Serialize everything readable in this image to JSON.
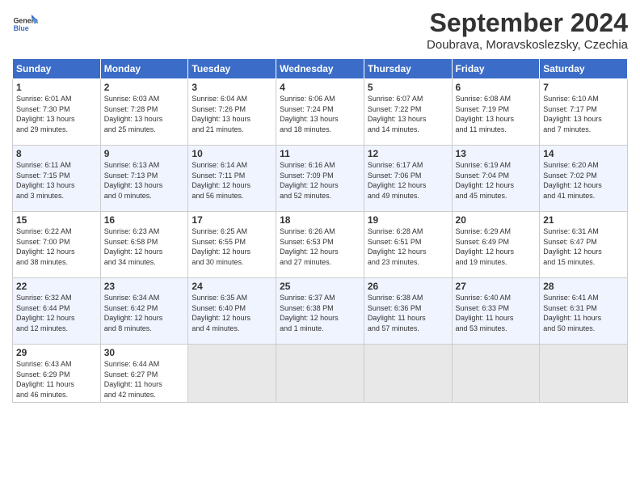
{
  "header": {
    "logo_line1": "General",
    "logo_line2": "Blue",
    "month_title": "September 2024",
    "location": "Doubrava, Moravskoslezsky, Czechia"
  },
  "days_of_week": [
    "Sunday",
    "Monday",
    "Tuesday",
    "Wednesday",
    "Thursday",
    "Friday",
    "Saturday"
  ],
  "weeks": [
    [
      {
        "day": "1",
        "info": "Sunrise: 6:01 AM\nSunset: 7:30 PM\nDaylight: 13 hours\nand 29 minutes."
      },
      {
        "day": "2",
        "info": "Sunrise: 6:03 AM\nSunset: 7:28 PM\nDaylight: 13 hours\nand 25 minutes."
      },
      {
        "day": "3",
        "info": "Sunrise: 6:04 AM\nSunset: 7:26 PM\nDaylight: 13 hours\nand 21 minutes."
      },
      {
        "day": "4",
        "info": "Sunrise: 6:06 AM\nSunset: 7:24 PM\nDaylight: 13 hours\nand 18 minutes."
      },
      {
        "day": "5",
        "info": "Sunrise: 6:07 AM\nSunset: 7:22 PM\nDaylight: 13 hours\nand 14 minutes."
      },
      {
        "day": "6",
        "info": "Sunrise: 6:08 AM\nSunset: 7:19 PM\nDaylight: 13 hours\nand 11 minutes."
      },
      {
        "day": "7",
        "info": "Sunrise: 6:10 AM\nSunset: 7:17 PM\nDaylight: 13 hours\nand 7 minutes."
      }
    ],
    [
      {
        "day": "8",
        "info": "Sunrise: 6:11 AM\nSunset: 7:15 PM\nDaylight: 13 hours\nand 3 minutes."
      },
      {
        "day": "9",
        "info": "Sunrise: 6:13 AM\nSunset: 7:13 PM\nDaylight: 13 hours\nand 0 minutes."
      },
      {
        "day": "10",
        "info": "Sunrise: 6:14 AM\nSunset: 7:11 PM\nDaylight: 12 hours\nand 56 minutes."
      },
      {
        "day": "11",
        "info": "Sunrise: 6:16 AM\nSunset: 7:09 PM\nDaylight: 12 hours\nand 52 minutes."
      },
      {
        "day": "12",
        "info": "Sunrise: 6:17 AM\nSunset: 7:06 PM\nDaylight: 12 hours\nand 49 minutes."
      },
      {
        "day": "13",
        "info": "Sunrise: 6:19 AM\nSunset: 7:04 PM\nDaylight: 12 hours\nand 45 minutes."
      },
      {
        "day": "14",
        "info": "Sunrise: 6:20 AM\nSunset: 7:02 PM\nDaylight: 12 hours\nand 41 minutes."
      }
    ],
    [
      {
        "day": "15",
        "info": "Sunrise: 6:22 AM\nSunset: 7:00 PM\nDaylight: 12 hours\nand 38 minutes."
      },
      {
        "day": "16",
        "info": "Sunrise: 6:23 AM\nSunset: 6:58 PM\nDaylight: 12 hours\nand 34 minutes."
      },
      {
        "day": "17",
        "info": "Sunrise: 6:25 AM\nSunset: 6:55 PM\nDaylight: 12 hours\nand 30 minutes."
      },
      {
        "day": "18",
        "info": "Sunrise: 6:26 AM\nSunset: 6:53 PM\nDaylight: 12 hours\nand 27 minutes."
      },
      {
        "day": "19",
        "info": "Sunrise: 6:28 AM\nSunset: 6:51 PM\nDaylight: 12 hours\nand 23 minutes."
      },
      {
        "day": "20",
        "info": "Sunrise: 6:29 AM\nSunset: 6:49 PM\nDaylight: 12 hours\nand 19 minutes."
      },
      {
        "day": "21",
        "info": "Sunrise: 6:31 AM\nSunset: 6:47 PM\nDaylight: 12 hours\nand 15 minutes."
      }
    ],
    [
      {
        "day": "22",
        "info": "Sunrise: 6:32 AM\nSunset: 6:44 PM\nDaylight: 12 hours\nand 12 minutes."
      },
      {
        "day": "23",
        "info": "Sunrise: 6:34 AM\nSunset: 6:42 PM\nDaylight: 12 hours\nand 8 minutes."
      },
      {
        "day": "24",
        "info": "Sunrise: 6:35 AM\nSunset: 6:40 PM\nDaylight: 12 hours\nand 4 minutes."
      },
      {
        "day": "25",
        "info": "Sunrise: 6:37 AM\nSunset: 6:38 PM\nDaylight: 12 hours\nand 1 minute."
      },
      {
        "day": "26",
        "info": "Sunrise: 6:38 AM\nSunset: 6:36 PM\nDaylight: 11 hours\nand 57 minutes."
      },
      {
        "day": "27",
        "info": "Sunrise: 6:40 AM\nSunset: 6:33 PM\nDaylight: 11 hours\nand 53 minutes."
      },
      {
        "day": "28",
        "info": "Sunrise: 6:41 AM\nSunset: 6:31 PM\nDaylight: 11 hours\nand 50 minutes."
      }
    ],
    [
      {
        "day": "29",
        "info": "Sunrise: 6:43 AM\nSunset: 6:29 PM\nDaylight: 11 hours\nand 46 minutes."
      },
      {
        "day": "30",
        "info": "Sunrise: 6:44 AM\nSunset: 6:27 PM\nDaylight: 11 hours\nand 42 minutes."
      },
      {
        "day": "",
        "info": ""
      },
      {
        "day": "",
        "info": ""
      },
      {
        "day": "",
        "info": ""
      },
      {
        "day": "",
        "info": ""
      },
      {
        "day": "",
        "info": ""
      }
    ]
  ]
}
